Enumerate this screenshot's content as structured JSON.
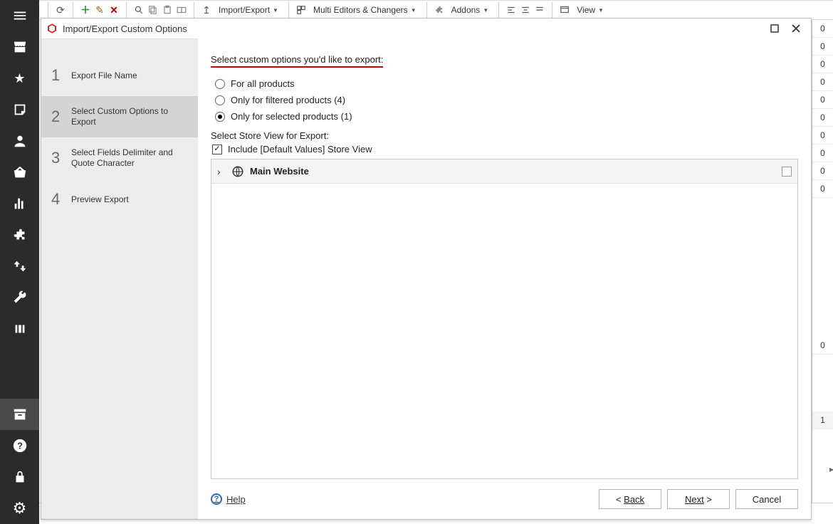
{
  "toolbar": {
    "menus": {
      "importExport": "Import/Export",
      "multiEditors": "Multi Editors & Changers",
      "addons": "Addons",
      "view": "View"
    }
  },
  "dialog": {
    "title": "Import/Export Custom Options",
    "steps": [
      {
        "n": "1",
        "label": "Export File Name"
      },
      {
        "n": "2",
        "label": "Select Custom Options to Export"
      },
      {
        "n": "3",
        "label": "Select Fields Delimiter and Quote Character"
      },
      {
        "n": "4",
        "label": "Preview Export"
      }
    ],
    "section1Title": "Select custom options you'd like to export:",
    "radios": {
      "all": "For all products",
      "filtered": "Only for filtered products (4)",
      "selected": "Only for selected products (1)"
    },
    "section2Title": "Select Store View for Export:",
    "includeDefault": "Include [Default Values] Store View",
    "treeRoot": "Main Website",
    "helpLabel": "Help",
    "buttons": {
      "back": "Back",
      "next": "Next",
      "cancel": "Cancel"
    }
  },
  "bgTable": {
    "cells": [
      "0",
      "0",
      "0",
      "0",
      "0",
      "0",
      "0",
      "0",
      "0",
      "0"
    ],
    "farCells": [
      "0",
      "1"
    ]
  }
}
